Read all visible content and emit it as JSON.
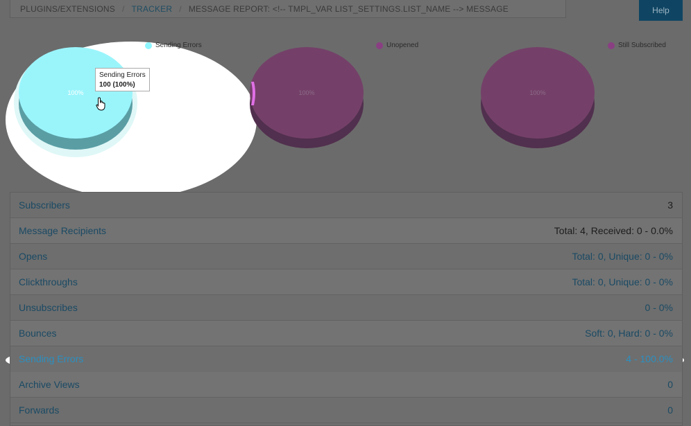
{
  "breadcrumb": {
    "item1": "PLUGINS/EXTENSIONS",
    "item2": "TRACKER",
    "item3": "MESSAGE REPORT: <!-- TMPL_VAR LIST_SETTINGS.LIST_NAME --> MESSAGE",
    "separator": "/"
  },
  "help_label": "Help",
  "charts": [
    {
      "legend": "Sending Errors",
      "label": "100%",
      "color": "#8ff6ff"
    },
    {
      "legend": "Unopened",
      "label": "100%",
      "color": "#733f6b"
    },
    {
      "legend": "Still Subscribed",
      "label": "100%",
      "color": "#733f6b"
    }
  ],
  "tooltip": {
    "title": "Sending Errors",
    "value": "100 (100%)"
  },
  "rows": [
    {
      "label": "Subscribers",
      "value": "3"
    },
    {
      "label": "Message Recipients",
      "value": "Total: 4, Received: 0 - 0.0%"
    },
    {
      "label": "Opens",
      "value": "Total: 0, Unique: 0 - 0%"
    },
    {
      "label": "Clickthroughs",
      "value": "Total: 0, Unique: 0 - 0%"
    },
    {
      "label": "Unsubscribes",
      "value": "0 - 0%"
    },
    {
      "label": "Bounces",
      "value": "Soft: 0, Hard: 0 - 0%"
    },
    {
      "label": "Sending Errors",
      "value": "4 - 100.0%"
    },
    {
      "label": "Archive Views",
      "value": "0"
    },
    {
      "label": "Forwards",
      "value": "0"
    }
  ]
}
